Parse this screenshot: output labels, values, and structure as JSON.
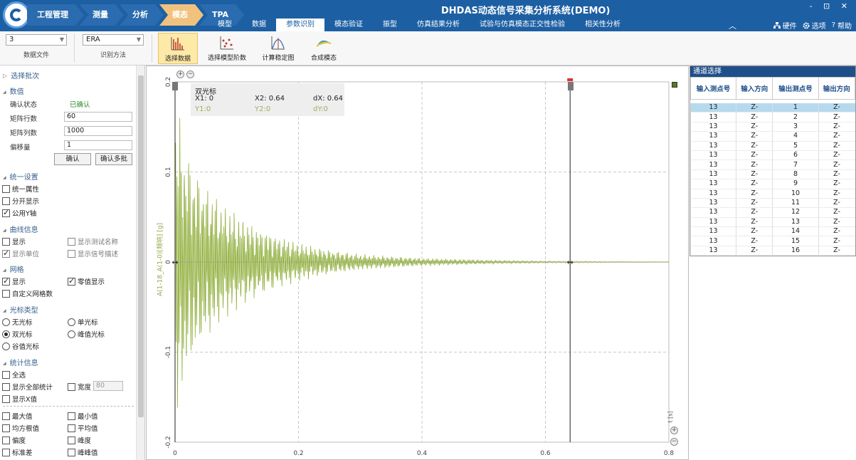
{
  "app": {
    "title": "DHDAS动态信号采集分析系统(DEMO)",
    "window_controls": "- ⊡ ✕",
    "collapse_glyph": "︿"
  },
  "workflow": [
    "工程管理",
    "测量",
    "分析",
    "模态",
    "TPA"
  ],
  "tabs": [
    "模型",
    "数据",
    "参数识别",
    "模态验证",
    "振型",
    "仿真结果分析",
    "试验与仿真模态正交性检验",
    "相关性分析"
  ],
  "active_tab": "参数识别",
  "right_tools": {
    "hardware": "硬件",
    "options": "选项",
    "help": "帮助"
  },
  "ribbon": {
    "data_file_value": "3",
    "data_file_caption": "数据文件",
    "method_value": "ERA",
    "method_caption": "识别方法",
    "buttons": [
      "选择数据",
      "选择模型阶数",
      "计算稳定图",
      "合成模态"
    ]
  },
  "left": {
    "select_batch": "选择批次",
    "values_section": "数值",
    "confirm_state_label": "确认状态",
    "confirm_state_value": "已确认",
    "rows_label": "矩阵行数",
    "rows_value": "60",
    "cols_label": "矩阵列数",
    "cols_value": "1000",
    "offset_label": "偏移量",
    "offset_value": "1",
    "confirm_btn": "确认",
    "confirm_multi_btn": "确认多批",
    "unified_section": "统一设置",
    "unify_attr": "统一属性",
    "split_display": "分开显示",
    "shared_y": "公用Y轴",
    "curve_section": "曲线信息",
    "show": "显示",
    "show_test_name": "显示测试名称",
    "show_unit": "显示单位",
    "show_signal_desc": "显示信号描述",
    "grid_section": "网格",
    "grid_show": "显示",
    "zero_show": "零值显示",
    "custom_grid": "自定义网格数",
    "cursor_section": "光标类型",
    "no_cursor": "无光标",
    "single_cursor": "单光标",
    "double_cursor": "双光标",
    "peak_cursor": "峰值光标",
    "valley_cursor": "谷值光标",
    "stats_section": "统计信息",
    "select_all": "全选",
    "show_all_stats": "显示全部统计",
    "width_label": "宽度",
    "width_value": "80",
    "show_x": "显示X值",
    "max": "最大值",
    "min": "最小值",
    "rms": "均方根值",
    "mean": "平均值",
    "skew": "偏度",
    "kurtosis": "峰度",
    "std": "标准差",
    "peak_peak": "峰峰值"
  },
  "cursor": {
    "title": "双光标",
    "x1": "X1: 0",
    "x2": "X2: 0.64",
    "dx": "dX: 0.64",
    "y1": "Y1:0",
    "y2": "Y2:0",
    "dy": "dY:0"
  },
  "chart_data": {
    "type": "line",
    "ylabel": "A(1-18_A(1-0)[频响] [g]",
    "xunit": "t [s]",
    "xlim": [
      0,
      0.8
    ],
    "ylim": [
      -0.2,
      0.2
    ],
    "xticks": [
      "0",
      "0.2",
      "0.4",
      "0.6",
      "0.8"
    ],
    "yticks": [
      "0.2",
      "0.1",
      "0",
      "-0.1",
      "-0.2"
    ],
    "grid": true,
    "cursor_x": [
      0,
      0.64
    ],
    "series": [
      {
        "color": "#8fae3a",
        "description": "decaying oscillation",
        "x": [
          0.0,
          0.005,
          0.01,
          0.015,
          0.02,
          0.03,
          0.05,
          0.08,
          0.12,
          0.16,
          0.2,
          0.25,
          0.3,
          0.4,
          0.5,
          0.6,
          0.7,
          0.8
        ],
        "envelope": [
          0.15,
          0.14,
          0.12,
          0.11,
          0.1,
          0.085,
          0.07,
          0.05,
          0.035,
          0.025,
          0.017,
          0.011,
          0.007,
          0.0035,
          0.0018,
          0.0009,
          0.0005,
          0.0003
        ]
      }
    ]
  },
  "channels": {
    "title": "通道选择",
    "headers": [
      "输入测点号",
      "输入方向",
      "输出测点号",
      "输出方向"
    ],
    "rows": [
      [
        "13",
        "Z-",
        "1",
        "Z-"
      ],
      [
        "13",
        "Z-",
        "2",
        "Z-"
      ],
      [
        "13",
        "Z-",
        "3",
        "Z-"
      ],
      [
        "13",
        "Z-",
        "4",
        "Z-"
      ],
      [
        "13",
        "Z-",
        "5",
        "Z-"
      ],
      [
        "13",
        "Z-",
        "6",
        "Z-"
      ],
      [
        "13",
        "Z-",
        "7",
        "Z-"
      ],
      [
        "13",
        "Z-",
        "8",
        "Z-"
      ],
      [
        "13",
        "Z-",
        "9",
        "Z-"
      ],
      [
        "13",
        "Z-",
        "10",
        "Z-"
      ],
      [
        "13",
        "Z-",
        "11",
        "Z-"
      ],
      [
        "13",
        "Z-",
        "12",
        "Z-"
      ],
      [
        "13",
        "Z-",
        "13",
        "Z-"
      ],
      [
        "13",
        "Z-",
        "14",
        "Z-"
      ],
      [
        "13",
        "Z-",
        "15",
        "Z-"
      ],
      [
        "13",
        "Z-",
        "16",
        "Z-"
      ]
    ]
  }
}
